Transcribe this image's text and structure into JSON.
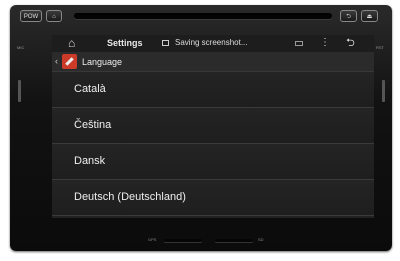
{
  "hardware": {
    "power_label": "POW",
    "home_icon": "home-icon",
    "back_icon": "back-icon",
    "eject_icon": "eject-icon",
    "side_left_label": "MIC",
    "side_right_label": "RST",
    "bottom_left_label": "GPS",
    "bottom_right_label": "SD"
  },
  "status_bar": {
    "home_icon": "home-outline-icon",
    "title": "Settings",
    "notification": "Saving screenshot...",
    "screenshot_icon": "screenshot-icon",
    "cast_icon": "cast-icon",
    "menu_icon": "overflow-menu-icon",
    "back_icon": "back-arrow-icon"
  },
  "action_bar": {
    "up_icon": "chevron-left-icon",
    "app_icon": "settings-wrench-icon",
    "title": "Language"
  },
  "languages": [
    "Català",
    "Čeština",
    "Dansk",
    "Deutsch (Deutschland)"
  ],
  "colors": {
    "screen_bg": "#222222",
    "text": "#efefef",
    "app_icon": "#cc3a2a"
  }
}
